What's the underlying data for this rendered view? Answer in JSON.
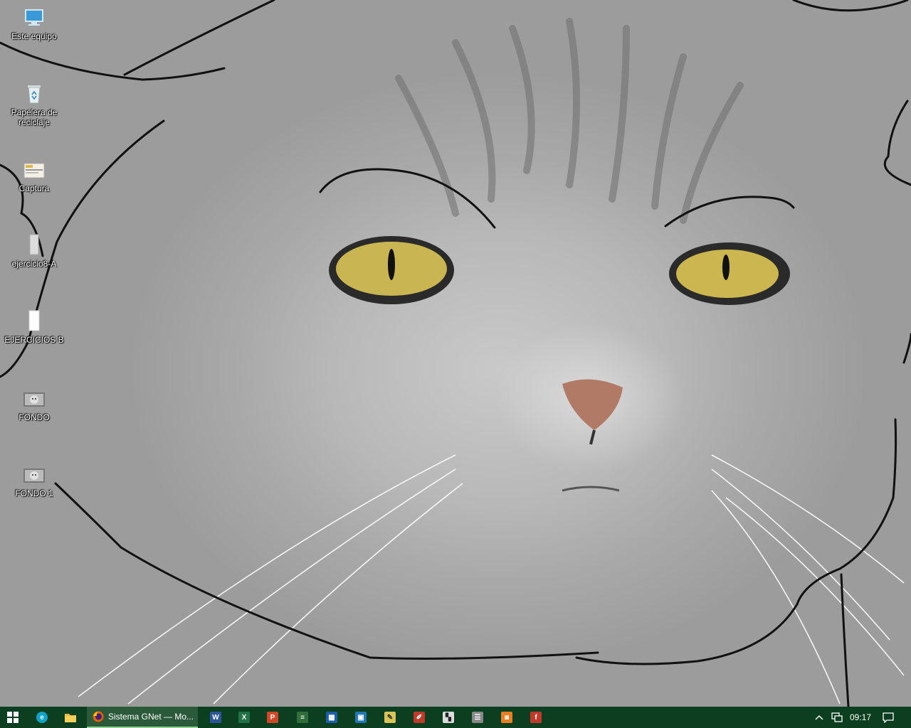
{
  "desktop_icons": [
    {
      "name": "este-equipo",
      "label": "Este equipo",
      "icon": "computer-icon"
    },
    {
      "name": "papelera",
      "label": "Papelera de reciclaje",
      "icon": "recycle-bin-icon"
    },
    {
      "name": "captura",
      "label": "Captura",
      "icon": "image-file-icon"
    },
    {
      "name": "ejercicio8a",
      "label": "ejercicio8-A",
      "icon": "document-icon"
    },
    {
      "name": "ejercicios-b",
      "label": "EJERCICIOS B",
      "icon": "document-icon"
    },
    {
      "name": "fondo",
      "label": "FONDO",
      "icon": "image-file-icon"
    },
    {
      "name": "fondo-1",
      "label": "FONDO 1",
      "icon": "image-file-icon"
    }
  ],
  "taskbar": {
    "start_icon": "windows-start-icon",
    "active_task_label": "Sistema GNet — Mo...",
    "pinned": [
      {
        "name": "edge",
        "icon": "edge-icon",
        "color": "#0fa3c9",
        "glyph": "e"
      },
      {
        "name": "explorer",
        "icon": "file-explorer-icon",
        "color": "#e8b93a",
        "glyph": ""
      },
      {
        "name": "word",
        "icon": "word-icon",
        "color": "#2b579a",
        "glyph": "W"
      },
      {
        "name": "excel",
        "icon": "excel-icon",
        "color": "#217346",
        "glyph": "X"
      },
      {
        "name": "powerpoint",
        "icon": "powerpoint-icon",
        "color": "#d24726",
        "glyph": "P"
      },
      {
        "name": "app1",
        "icon": "green-app-icon",
        "color": "#2f6e3a",
        "glyph": "≡"
      },
      {
        "name": "app2",
        "icon": "calculator-icon",
        "color": "#1b5fa8",
        "glyph": "▦"
      },
      {
        "name": "app3",
        "icon": "monitor-app-icon",
        "color": "#1f77b4",
        "glyph": "▣"
      },
      {
        "name": "app4",
        "icon": "notepad-icon",
        "color": "#d8c45a",
        "glyph": "✎"
      },
      {
        "name": "app5",
        "icon": "paint-icon",
        "color": "#c0392b",
        "glyph": "✐"
      },
      {
        "name": "app6",
        "icon": "chess-icon",
        "color": "#dddddd",
        "glyph": "▚"
      },
      {
        "name": "app7",
        "icon": "stack-icon",
        "color": "#888888",
        "glyph": "☰"
      },
      {
        "name": "app8",
        "icon": "orange-app-icon",
        "color": "#e67e22",
        "glyph": "◙"
      },
      {
        "name": "app9",
        "icon": "flash-icon",
        "color": "#c0392b",
        "glyph": "f"
      }
    ],
    "clock_time": "09:17"
  }
}
